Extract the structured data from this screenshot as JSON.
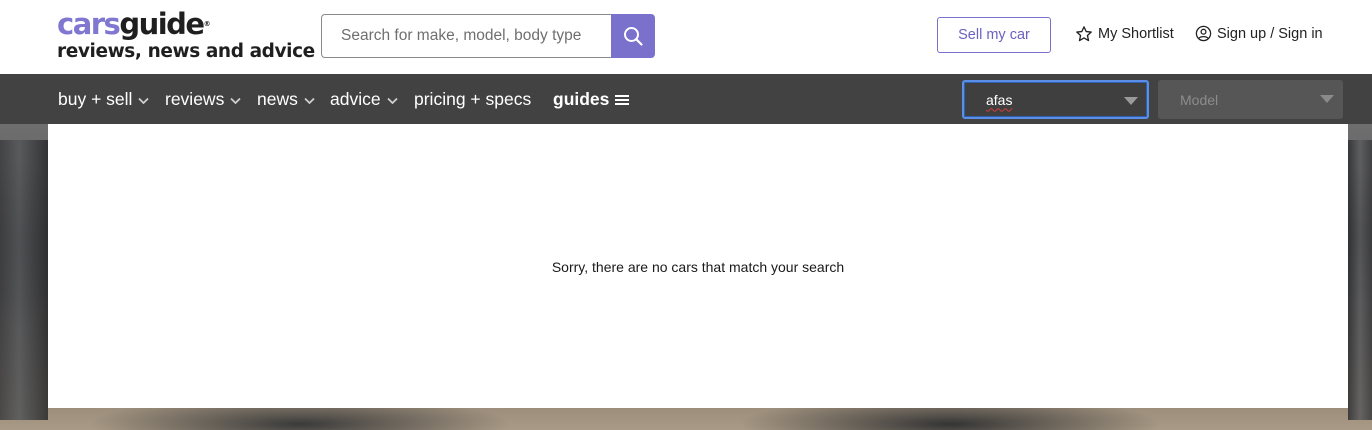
{
  "header": {
    "logo": {
      "part1": "cars",
      "part2": "guide",
      "reg": "®",
      "tagline": "reviews, news and advice"
    },
    "search": {
      "placeholder": "Search for make, model, body type",
      "value": ""
    },
    "sell_button": "Sell my car",
    "shortlist": "My Shortlist",
    "signin": "Sign up / Sign in"
  },
  "nav": {
    "items": [
      {
        "label": "buy + sell",
        "dropdown": true
      },
      {
        "label": "reviews",
        "dropdown": true
      },
      {
        "label": "news",
        "dropdown": true
      },
      {
        "label": "advice",
        "dropdown": true
      },
      {
        "label": "pricing + specs",
        "dropdown": false
      },
      {
        "label": "guides",
        "dropdown": false,
        "bold": true,
        "icon": "hamburger-icon"
      }
    ],
    "make_select": {
      "value": "afas"
    },
    "model_select": {
      "placeholder": "Model"
    }
  },
  "results": {
    "message": "Sorry, there are no cars that match your search"
  },
  "colors": {
    "brand": "#7f77d0",
    "nav_bg": "#424242",
    "accent_button": "#7a71cc"
  }
}
